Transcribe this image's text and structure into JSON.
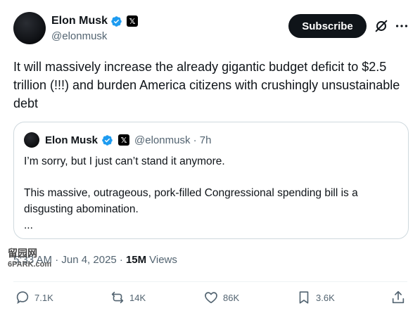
{
  "author": {
    "display_name": "Elon Musk",
    "handle": "@elonmusk",
    "affiliation_badge": "𝕏"
  },
  "header": {
    "subscribe_label": "Subscribe",
    "icons": [
      "grok-icon",
      "more-icon"
    ]
  },
  "tweet": {
    "text": "It will massively increase the already gigantic budget deficit to $2.5 trillion (!!!) and burden America citizens with crushingly unsustainable debt"
  },
  "quote": {
    "display_name": "Elon Musk",
    "affiliation_badge": "𝕏",
    "handle_time": "@elonmusk · 7h",
    "paragraph1": "I’m sorry, but I just can’t stand it anymore.",
    "paragraph2": "This massive, outrageous, pork-filled Congressional spending bill is a disgusting abomination.",
    "ellipsis": "..."
  },
  "meta": {
    "time_date": "5:33 AM · Jun 4, 2025 ·",
    "views_count": "15M",
    "views_label": "Views"
  },
  "watermark": {
    "line1": "留园网",
    "line2": "6PARK.com"
  },
  "actions": {
    "replies": "7.1K",
    "reposts": "14K",
    "likes": "86K",
    "bookmarks": "3.6K"
  },
  "colors": {
    "text": "#0f1419",
    "secondary": "#536471",
    "verified": "#1d9bf0",
    "border": "#cfd9de"
  }
}
